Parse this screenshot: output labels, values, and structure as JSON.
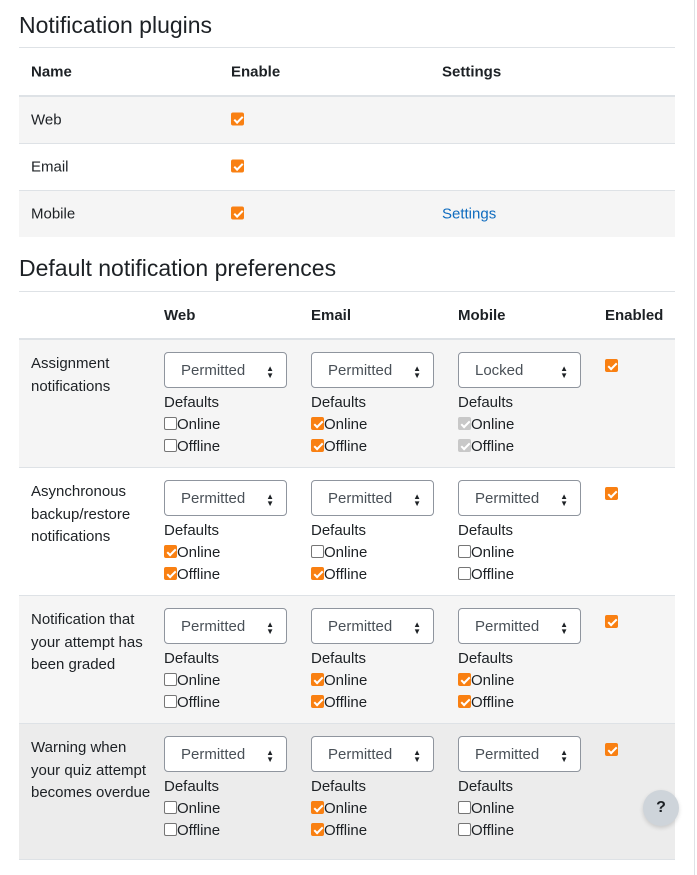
{
  "plugins_section": {
    "title": "Notification plugins",
    "headers": {
      "name": "Name",
      "enable": "Enable",
      "settings": "Settings"
    },
    "rows": [
      {
        "name": "Web",
        "enabled": true,
        "settings": ""
      },
      {
        "name": "Email",
        "enabled": true,
        "settings": ""
      },
      {
        "name": "Mobile",
        "enabled": true,
        "settings": "Settings"
      }
    ]
  },
  "prefs_section": {
    "title": "Default notification preferences",
    "headers": {
      "web": "Web",
      "email": "Email",
      "mobile": "Mobile",
      "enabled": "Enabled"
    },
    "defaults_label": "Defaults",
    "online_label": "Online",
    "offline_label": "Offline",
    "rows": [
      {
        "name": "Assignment notifications",
        "web": {
          "select": "Permitted",
          "online": false,
          "offline": false
        },
        "email": {
          "select": "Permitted",
          "online": true,
          "offline": true
        },
        "mobile": {
          "select": "Locked",
          "online": true,
          "offline": true
        },
        "enabled": true
      },
      {
        "name": "Asynchronous backup/restore notifications",
        "web": {
          "select": "Permitted",
          "online": true,
          "offline": true
        },
        "email": {
          "select": "Permitted",
          "online": false,
          "offline": true
        },
        "mobile": {
          "select": "Permitted",
          "online": false,
          "offline": false
        },
        "enabled": true
      },
      {
        "name": "Notification that your attempt has been graded",
        "web": {
          "select": "Permitted",
          "online": false,
          "offline": false
        },
        "email": {
          "select": "Permitted",
          "online": true,
          "offline": true
        },
        "mobile": {
          "select": "Permitted",
          "online": true,
          "offline": true
        },
        "enabled": true
      },
      {
        "name": "Warning when your quiz attempt becomes overdue",
        "web": {
          "select": "Permitted",
          "online": false,
          "offline": false
        },
        "email": {
          "select": "Permitted",
          "online": true,
          "offline": true
        },
        "mobile": {
          "select": "Permitted",
          "online": false,
          "offline": false
        },
        "enabled": true
      }
    ]
  },
  "help_button": {
    "label": "?"
  },
  "colors": {
    "accent": "#f98012",
    "link": "#0f6cbf",
    "border": "#dee2e6",
    "stripe": "#f5f5f5"
  }
}
